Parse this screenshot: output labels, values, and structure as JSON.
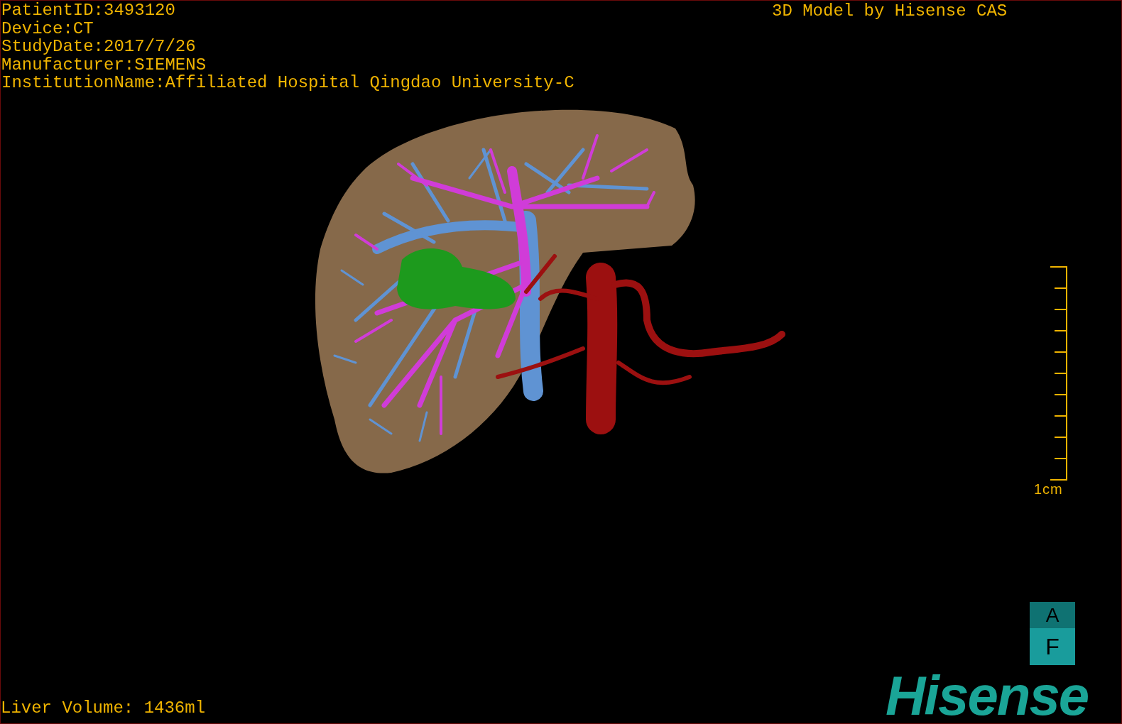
{
  "patient_info": [
    "PatientID:3493120",
    "Device:CT",
    "StudyDate:2017/7/26",
    "Manufacturer:SIEMENS",
    "InstitutionName:Affiliated Hospital Qingdao University-C"
  ],
  "header_right": "3D Model by Hisense CAS",
  "scale_bar": {
    "label": "1cm"
  },
  "orientation_marker": {
    "top_label": "A",
    "bottom_label": "F"
  },
  "logo": "Hisense",
  "liver_volume": "Liver Volume: 1436ml"
}
